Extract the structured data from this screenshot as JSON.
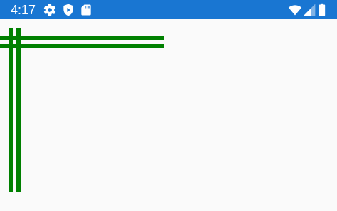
{
  "status_bar": {
    "time": "4:17",
    "background_color": "#1976d2",
    "icons_left": [
      "gear-icon",
      "play-protect-icon",
      "sd-card-icon"
    ],
    "icons_right": [
      "wifi-icon",
      "cell-signal-icon",
      "battery-icon"
    ]
  },
  "canvas": {
    "background_color": "#fafafa",
    "line_color": "#008000",
    "horizontal_lines": 2,
    "vertical_lines": 2
  }
}
